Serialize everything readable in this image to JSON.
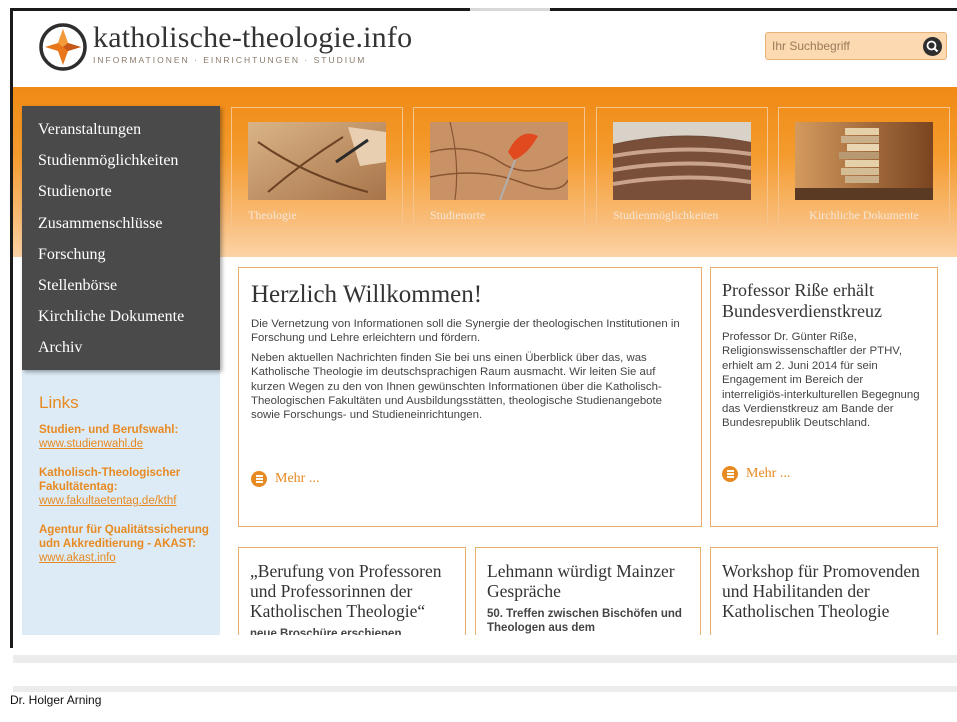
{
  "header": {
    "title": "katholische-theologie.info",
    "subtitle": "INFORMATIONEN · EINRICHTUNGEN · STUDIUM",
    "search_placeholder": "Ihr Suchbegriff"
  },
  "nav": {
    "items": [
      "Veranstaltungen",
      "Studienmöglichkeiten",
      "Studienorte",
      "Zusammenschlüsse",
      "Forschung",
      "Stellenbörse",
      "Kirchliche Dokumente",
      "Archiv"
    ]
  },
  "tiles": [
    "Theologie",
    "Studienorte",
    "Studienmöglichkeiten",
    "Kirchliche Dokumente"
  ],
  "links": {
    "title": "Links",
    "groups": [
      {
        "name": "Studien- und Berufswahl:",
        "url": "www.studienwahl.de"
      },
      {
        "name": "Katholisch-Theologischer Fakultätentag:",
        "url": "www.fakultaetentag.de/kthf"
      },
      {
        "name": "Agentur für Qualitätssicherung udn Akkreditierung - AKAST:",
        "url": "www.akast.info"
      }
    ]
  },
  "welcome": {
    "title": "Herzlich Willkommen!",
    "p1": "Die Vernetzung von Informationen soll die Synergie der theologischen Institutionen in Forschung und Lehre erleichtern und fördern.",
    "p2": "Neben aktuellen Nachrichten finden Sie bei uns einen Überblick über das, was Katholische Theologie im deutschsprachigen Raum ausmacht. Wir leiten Sie auf kurzen Wegen zu den von Ihnen gewünschten Informationen über die Katholisch-Theologischen Fakultäten und Ausbildungsstätten, theologische Studienangebote sowie Forschungs- und Studieneinrichtungen.",
    "more": "Mehr ..."
  },
  "news": {
    "title": "Professor Riße erhält Bundesverdienstkreuz",
    "text": "Professor Dr. Günter Riße, Religionswissenschaftler der PTHV, erhielt am 2. Juni 2014 für sein Engagement im Bereich der interreligiös-interkulturellen Begegnung das Verdienstkreuz am Bande der Bundesrepublik Deutschland.",
    "more": "Mehr ..."
  },
  "cards": [
    {
      "title": "„Berufung von Professoren und Professorinnen der Katholischen Theologie“",
      "sub": "neue Broschüre erschienen"
    },
    {
      "title": "Lehmann würdigt Mainzer Gespräche",
      "sub": "50. Treffen zwischen Bischöfen und Theologen aus dem"
    },
    {
      "title": "Workshop für Promovenden und Habilitanden der Katholischen Theologie",
      "sub": ""
    }
  ],
  "footer": {
    "author": "Dr. Holger Arning"
  },
  "colors": {
    "accent": "#e88a22",
    "nav_bg": "#4a4a4a",
    "links_bg": "#dcebf6"
  }
}
